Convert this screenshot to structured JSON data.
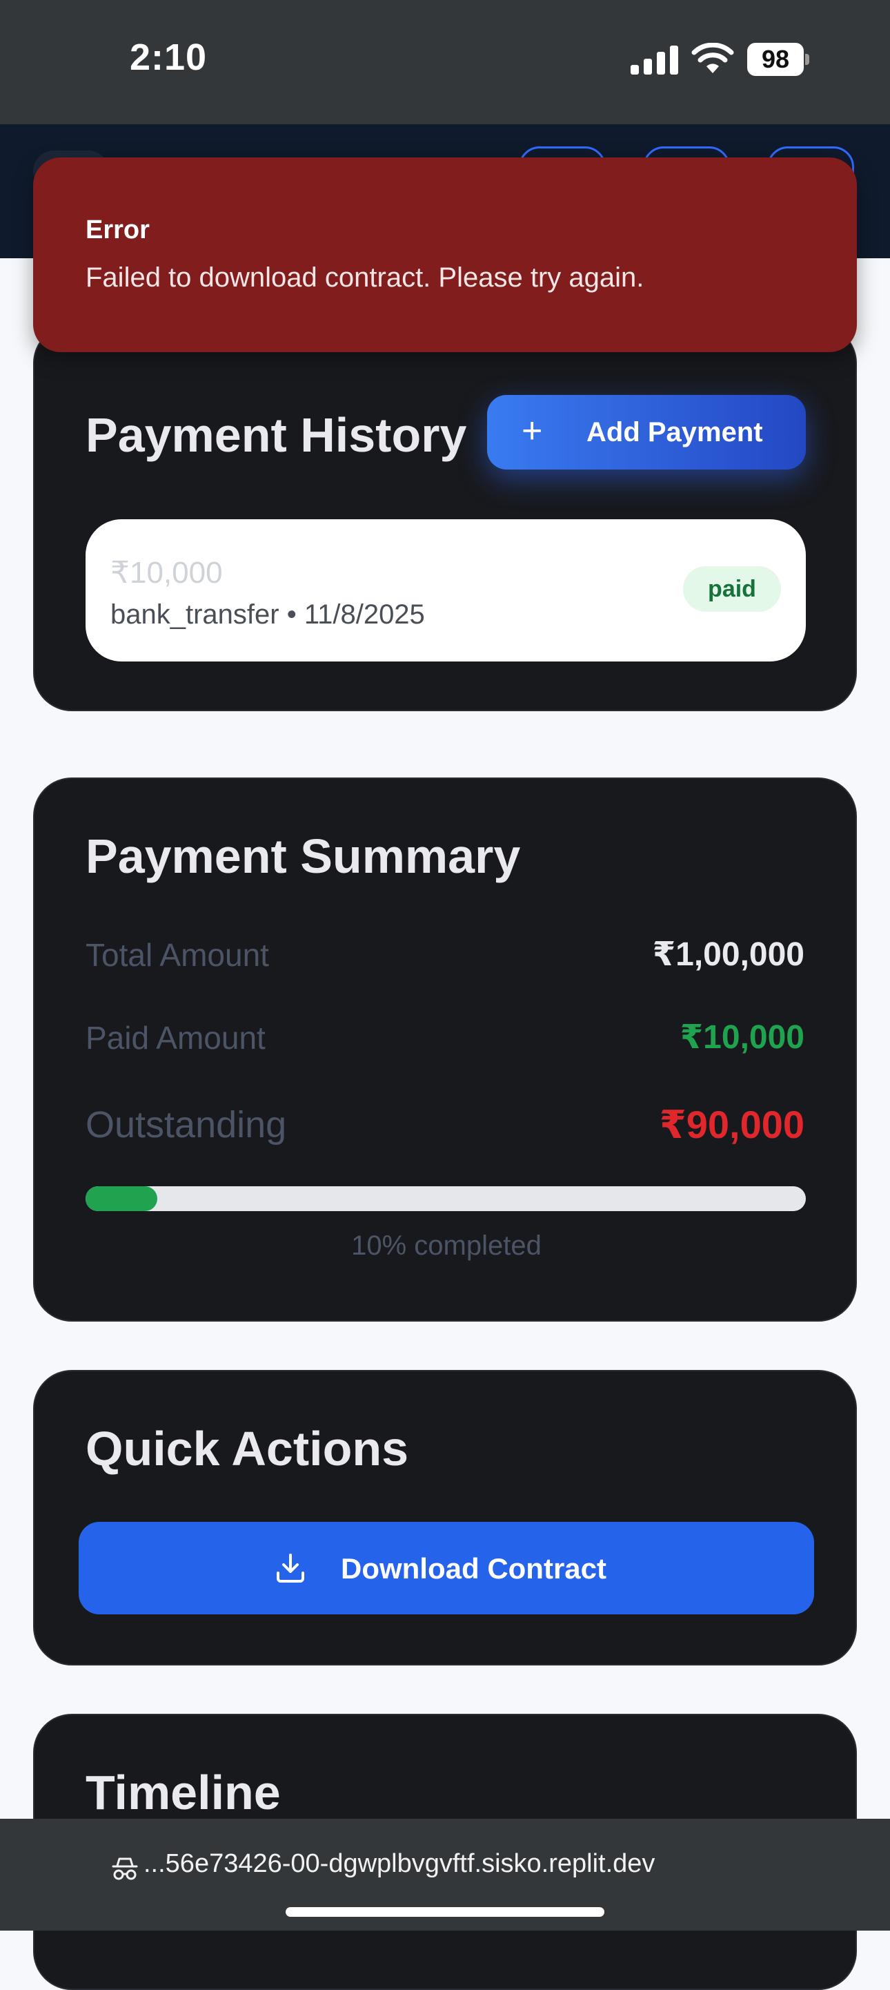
{
  "status_bar": {
    "time": "2:10",
    "battery": "98"
  },
  "toast": {
    "title": "Error",
    "message": "Failed to download contract. Please try again."
  },
  "payment_history": {
    "title": "Payment History",
    "add_button_label": "Add Payment",
    "items": [
      {
        "amount": "₹10,000",
        "method_date": "bank_transfer • 11/8/2025",
        "status": "paid"
      }
    ]
  },
  "payment_summary": {
    "title": "Payment Summary",
    "rows": [
      {
        "label": "Total Amount",
        "value": "₹1,00,000"
      },
      {
        "label": "Paid Amount",
        "value": "₹10,000"
      },
      {
        "label": "Outstanding",
        "value": "₹90,000"
      }
    ],
    "progress_fraction": 0.1,
    "progress_text": "10% completed",
    "colors": {
      "paid": "#1fa34f",
      "outstanding": "#e0272c"
    }
  },
  "quick_actions": {
    "title": "Quick Actions",
    "download_label": "Download Contract"
  },
  "timeline": {
    "title": "Timeline"
  },
  "browser": {
    "url": "...56e73426-00-dgwplbvgvftf.sisko.replit.dev"
  }
}
